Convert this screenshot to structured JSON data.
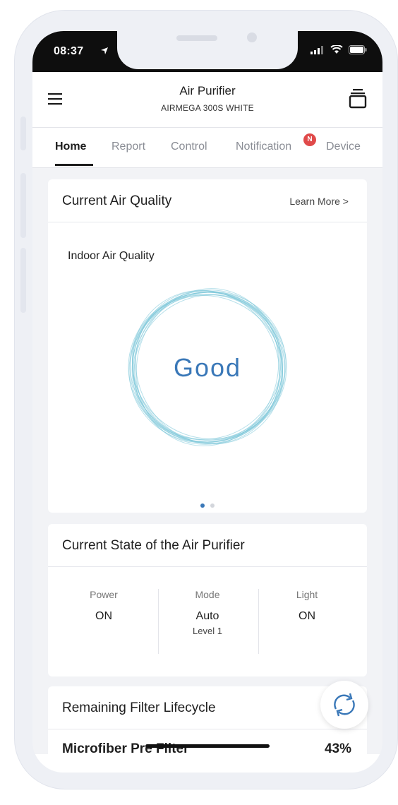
{
  "status_bar": {
    "time": "08:37"
  },
  "app_bar": {
    "title": "Air Purifier",
    "subtitle": "AIRMEGA 300S WHITE"
  },
  "tabs": [
    {
      "label": "Home",
      "active": true
    },
    {
      "label": "Report",
      "active": false
    },
    {
      "label": "Control",
      "active": false
    },
    {
      "label": "Notification",
      "active": false,
      "badge": "N"
    },
    {
      "label": "Device",
      "active": false
    }
  ],
  "air_quality": {
    "title": "Current Air Quality",
    "learn_more": "Learn More >",
    "section_label": "Indoor Air Quality",
    "status": "Good",
    "page_count": 2,
    "active_page": 0
  },
  "state": {
    "title": "Current State of the Air Purifier",
    "items": [
      {
        "label": "Power",
        "value": "ON",
        "sub": ""
      },
      {
        "label": "Mode",
        "value": "Auto",
        "sub": "Level 1"
      },
      {
        "label": "Light",
        "value": "ON",
        "sub": ""
      }
    ]
  },
  "filter": {
    "title": "Remaining Filter Lifecycle",
    "items": [
      {
        "name": "Microfiber Pre Filter",
        "percent": "43%"
      }
    ]
  },
  "colors": {
    "accent": "#3a78b8",
    "ring": "#7cc6d8",
    "badge": "#e04a4a",
    "dot_active": "#3a78b8",
    "dot_inactive": "#d3d6dc"
  }
}
